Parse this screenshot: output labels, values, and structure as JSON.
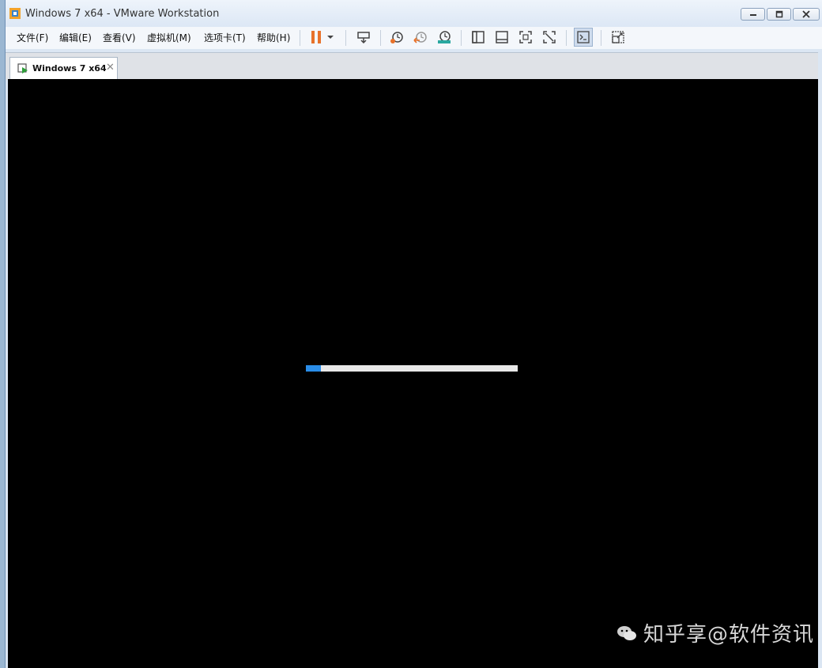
{
  "window": {
    "title": "Windows 7 x64 - VMware Workstation"
  },
  "menu": {
    "items": [
      {
        "label": "文件(F)"
      },
      {
        "label": "编辑(E)"
      },
      {
        "label": "查看(V)"
      },
      {
        "label": "虚拟机(M)"
      },
      {
        "label": "选项卡(T)"
      },
      {
        "label": "帮助(H)"
      }
    ]
  },
  "toolbar": {
    "icons": [
      "pause-icon",
      "dropdown-arrow-icon",
      "send-ctrl-alt-del-icon",
      "snapshot-icon",
      "revert-snapshot-icon",
      "snapshot-manager-icon",
      "show-library-icon",
      "show-thumbnail-bar-icon",
      "full-screen-icon",
      "unity-icon",
      "console-view-icon",
      "stretch-guest-icon"
    ]
  },
  "tabs": [
    {
      "label": "Windows 7 x64",
      "active": true
    }
  ],
  "vm": {
    "boot_progress_fraction": 0.07
  },
  "watermark": {
    "text": "知乎享@软件资讯"
  },
  "colors": {
    "accent": "#2a8de8",
    "pause": "#e8722a",
    "screen_bg": "#000000"
  }
}
